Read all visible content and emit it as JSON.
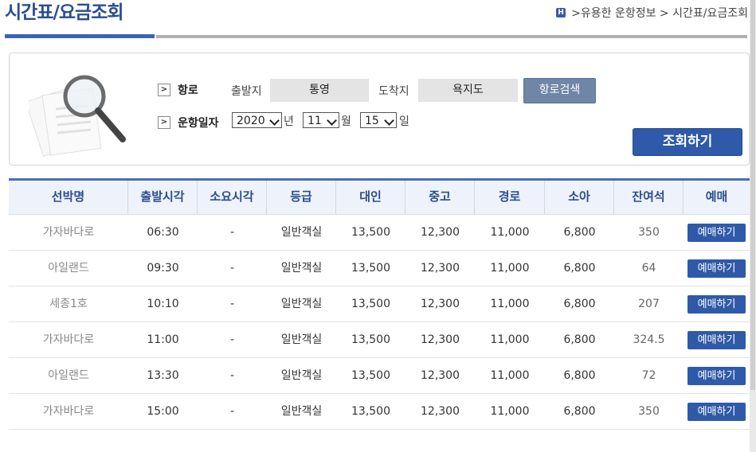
{
  "page_title": "시간표/요금조회",
  "breadcrumb": {
    "home_icon": "H",
    "path": ">유용한 운항정보 > 시간표/요금조회"
  },
  "search": {
    "route_label": "항로",
    "departure_label": "출발지",
    "departure_value": "통영",
    "arrival_label": "도착지",
    "arrival_value": "욕지도",
    "route_search_button": "항로검색",
    "date_label": "운항일자",
    "year_value": "2020",
    "year_unit": "년",
    "month_value": "11",
    "month_unit": "월",
    "day_value": "15",
    "day_unit": "일",
    "query_button": "조회하기"
  },
  "table": {
    "headers": [
      "선박명",
      "출발시각",
      "소요시각",
      "등급",
      "대인",
      "중고",
      "경로",
      "소아",
      "잔여석",
      "예매"
    ],
    "rows": [
      {
        "ship": "가자바다로",
        "time": "06:30",
        "duration": "-",
        "grade": "일반객실",
        "adult": "13,500",
        "teen": "12,300",
        "senior": "11,000",
        "child": "6,800",
        "remain": "350",
        "action": "예매하기"
      },
      {
        "ship": "아일랜드",
        "time": "09:30",
        "duration": "-",
        "grade": "일반객실",
        "adult": "13,500",
        "teen": "12,300",
        "senior": "11,000",
        "child": "6,800",
        "remain": "64",
        "action": "예매하기"
      },
      {
        "ship": "세종1호",
        "time": "10:10",
        "duration": "-",
        "grade": "일반객실",
        "adult": "13,500",
        "teen": "12,300",
        "senior": "11,000",
        "child": "6,800",
        "remain": "207",
        "action": "예매하기"
      },
      {
        "ship": "가자바다로",
        "time": "11:00",
        "duration": "-",
        "grade": "일반객실",
        "adult": "13,500",
        "teen": "12,300",
        "senior": "11,000",
        "child": "6,800",
        "remain": "324.5",
        "action": "예매하기"
      },
      {
        "ship": "아일랜드",
        "time": "13:30",
        "duration": "-",
        "grade": "일반객실",
        "adult": "13,500",
        "teen": "12,300",
        "senior": "11,000",
        "child": "6,800",
        "remain": "72",
        "action": "예매하기"
      },
      {
        "ship": "가자바다로",
        "time": "15:00",
        "duration": "-",
        "grade": "일반객실",
        "adult": "13,500",
        "teen": "12,300",
        "senior": "11,000",
        "child": "6,800",
        "remain": "350",
        "action": "예매하기"
      }
    ]
  },
  "colors": {
    "accent": "#2f5aa9",
    "header_text": "#2a4d8f",
    "route_button": "#6f86a6"
  }
}
